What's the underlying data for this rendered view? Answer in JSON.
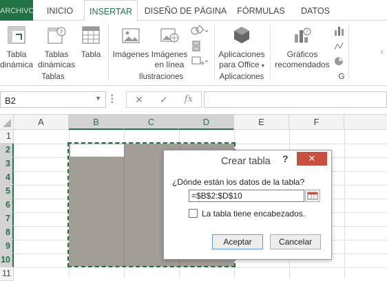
{
  "tabs": [
    "ARCHIVO",
    "INICIO",
    "INSERTAR",
    "DISEÑO DE PÁGINA",
    "FÓRMULAS",
    "DATOS"
  ],
  "ribbon": {
    "tablas": {
      "tabla_dinamica": [
        "Tabla",
        "dinámica"
      ],
      "tablas_dinamicas": [
        "Tablas",
        "dinámicas"
      ],
      "tabla": "Tabla",
      "label": "Tablas"
    },
    "ilustraciones": {
      "imagenes": "Imágenes",
      "imagenes_linea": [
        "Imágenes",
        "en línea"
      ],
      "label": "Ilustraciones"
    },
    "aplicaciones": {
      "aplicaciones_office": [
        "Aplicaciones",
        "para Office"
      ],
      "label": "Aplicaciones"
    },
    "graficos": {
      "graficos_recomendados": [
        "Gráficos",
        "recomendados"
      ],
      "label": "G"
    }
  },
  "formula_bar": {
    "name_box": "B2",
    "fx": "fx"
  },
  "grid": {
    "columns": [
      "A",
      "B",
      "C",
      "D",
      "E",
      "F"
    ],
    "rows": [
      "1",
      "2",
      "3",
      "4",
      "5",
      "6",
      "7",
      "8",
      "9",
      "10",
      "11"
    ]
  },
  "dialog": {
    "title": "Crear tabla",
    "help": "?",
    "question": "¿Dónde están los datos de la tabla?",
    "range_value": "=$B$2:$D$10",
    "checkbox_label": "La tabla tiene encabezados.",
    "accept_label": "Aceptar",
    "cancel_label": "Cancelar"
  },
  "colors": {
    "excel_green": "#217346",
    "selection_gray": "#a39d98",
    "close_red": "#c7503e"
  }
}
